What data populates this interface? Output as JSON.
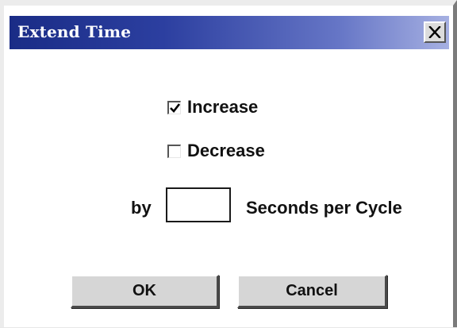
{
  "window": {
    "title": "Extend Time",
    "close_icon": "close-x-icon"
  },
  "options": {
    "increase": {
      "label": "Increase",
      "checked": true
    },
    "decrease": {
      "label": "Decrease",
      "checked": false
    }
  },
  "cycle": {
    "prefix": "by",
    "value": "",
    "suffix": "Seconds per Cycle"
  },
  "buttons": {
    "ok": "OK",
    "cancel": "Cancel"
  },
  "colors": {
    "titlebar_start": "#1a2c86",
    "titlebar_end": "#a6b0e2",
    "button_face": "#d6d6d6"
  }
}
